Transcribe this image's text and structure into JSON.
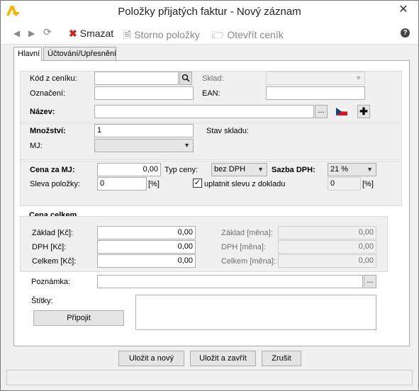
{
  "window": {
    "title": "Položky přijatých faktur - Nový záznam",
    "close": "✕"
  },
  "toolbar": {
    "back_icon": "◀",
    "forward_icon": "▶",
    "refresh_icon": "⟳",
    "delete_label": "Smazat",
    "storno_label": "Storno položky",
    "price_list_label": "Otevřít ceník",
    "help": "?"
  },
  "tabs": [
    {
      "label": "Hlavní"
    },
    {
      "label": "Účtování/Upřesnění"
    }
  ],
  "fields": {
    "kod_label": "Kód z ceníku:",
    "kod_value": "",
    "sklad_label": "Sklad:",
    "sklad_value": "",
    "oznaceni_label": "Označení:",
    "oznaceni_value": "",
    "ean_label": "EAN:",
    "ean_value": "",
    "nazev_label": "Název:",
    "nazev_value": "",
    "mnozstvi_label": "Množství:",
    "mnozstvi_value": "1",
    "stav_skladu_label": "Stav skladu:",
    "mj_label": "MJ:",
    "mj_value": "",
    "cena_mj_label": "Cena za MJ:",
    "cena_mj_value": "0,00",
    "typ_ceny_label": "Typ ceny:",
    "typ_ceny_value": "bez DPH",
    "sazba_dph_label": "Sazba DPH:",
    "sazba_dph_value": "21 %",
    "sleva_label": "Sleva položky:",
    "sleva_value": "0",
    "percent": "[%]",
    "uplatnit_label": "uplatnit slevu z dokladu",
    "uplatnit_checked": true,
    "doc_sleva_value": "0"
  },
  "cena_celkem": {
    "title": "Cena celkem",
    "zaklad_kc_label": "Základ [Kč]:",
    "zaklad_kc_value": "0,00",
    "dph_kc_label": "DPH [Kč]:",
    "dph_kc_value": "0,00",
    "celkem_kc_label": "Celkem [Kč]:",
    "celkem_kc_value": "0,00",
    "zaklad_mena_label": "Základ [měna]:",
    "zaklad_mena_value": "0,00",
    "dph_mena_label": "DPH [měna]:",
    "dph_mena_value": "0,00",
    "celkem_mena_label": "Celkem [měna]:",
    "celkem_mena_value": "0,00"
  },
  "poznamka": {
    "label": "Poznámka:",
    "value": ""
  },
  "stitky": {
    "label": "Štítky:",
    "attach_label": "Připojit",
    "value": ""
  },
  "ellipsis": "...",
  "buttons": {
    "save_new": "Uložit a nový",
    "save_close": "Uložit a zavřít",
    "cancel": "Zrušit"
  },
  "colors": {
    "logo": "#f2b705",
    "delete": "#cc2222",
    "flag_blue": "#11457e",
    "flag_red": "#d7141a"
  }
}
